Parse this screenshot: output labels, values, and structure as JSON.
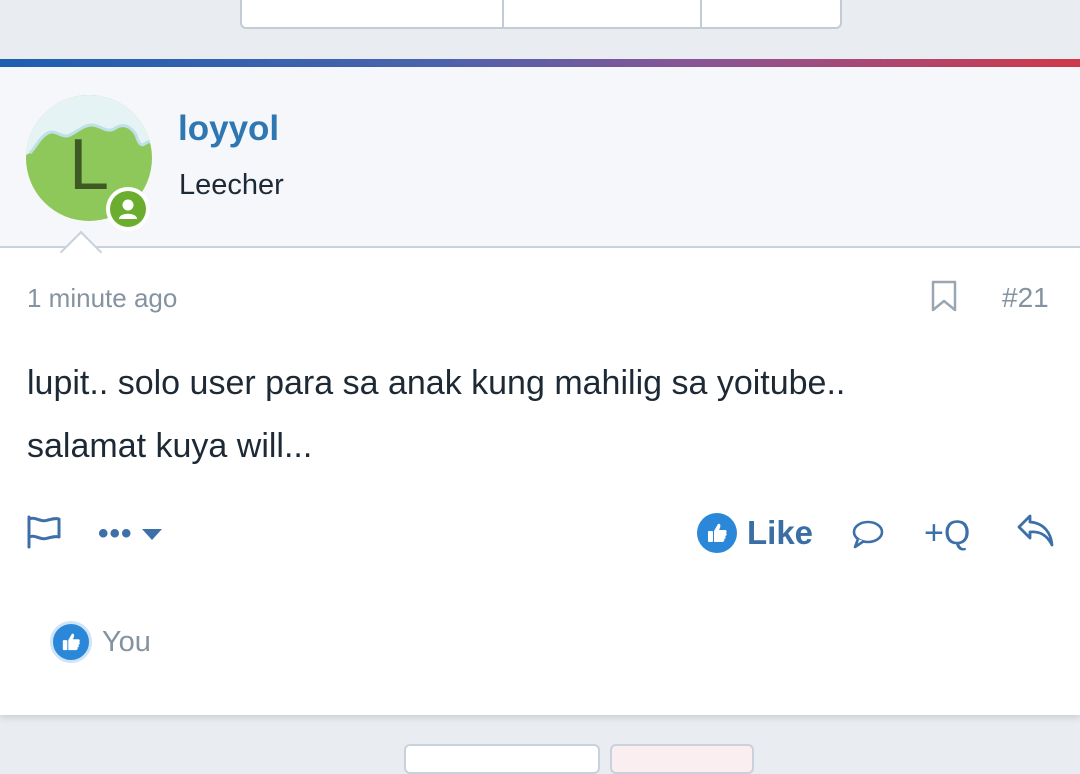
{
  "post": {
    "author": {
      "username": "loyyol",
      "title": "Leecher",
      "avatar_letter": "L",
      "online": true
    },
    "time": "1 minute ago",
    "number": "#21",
    "body_lines": [
      "lupit.. solo user para sa anak kung mahilig sa yoitube..",
      "salamat kuya will..."
    ]
  },
  "actions": {
    "more_label": "•••",
    "like_label": "Like",
    "quote_label": "+Q"
  },
  "reactions": {
    "summary": "You"
  },
  "icons": {
    "report": "flag-icon",
    "bookmark": "bookmark-icon",
    "comment": "comment-icon",
    "reply": "reply-icon",
    "like": "thumbs-up-icon",
    "online": "user-icon"
  },
  "colors": {
    "link": "#2f77b3",
    "action": "#3d6fa8",
    "like_blue": "#2b88d8",
    "online_green": "#6aad2f",
    "avatar_green": "#8fc85a",
    "muted": "#8593a1"
  }
}
